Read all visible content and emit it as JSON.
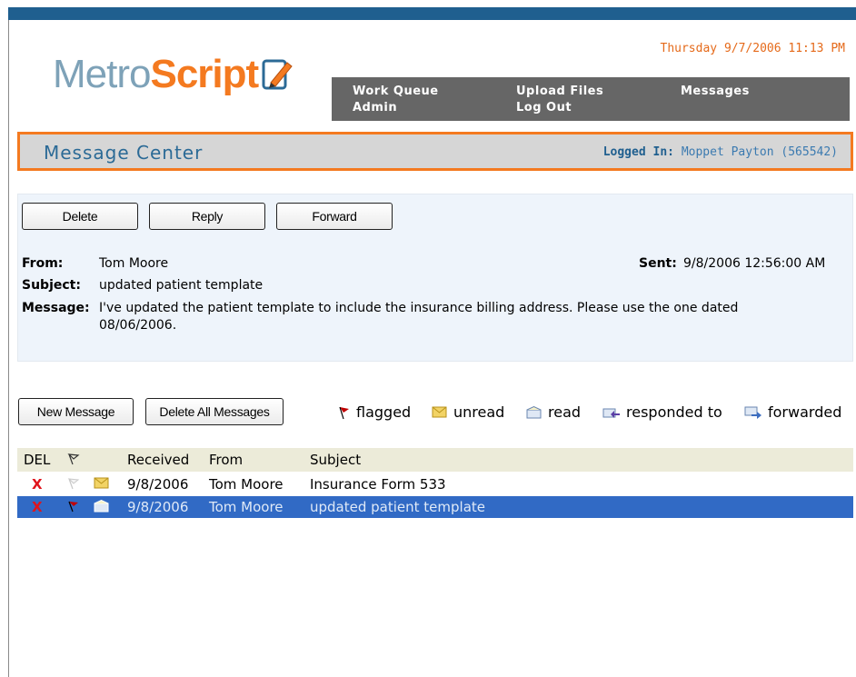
{
  "header": {
    "logo_part1": "Metro",
    "logo_part2": "Script",
    "datetime": "Thursday 9/7/2006 11:13 PM"
  },
  "nav": {
    "items": [
      {
        "label": "Work Queue"
      },
      {
        "label": "Admin"
      },
      {
        "label": "Upload Files"
      },
      {
        "label": "Log Out"
      },
      {
        "label": "Messages"
      }
    ]
  },
  "message_center": {
    "title": "Message Center",
    "logged_in_label": "Logged In:",
    "logged_in_user": "Moppet Payton (565542)"
  },
  "toolbar": {
    "delete_label": "Delete",
    "reply_label": "Reply",
    "forward_label": "Forward"
  },
  "message": {
    "from_label": "From:",
    "from_value": "Tom Moore",
    "sent_label": "Sent:",
    "sent_value": "9/8/2006 12:56:00 AM",
    "subject_label": "Subject:",
    "subject_value": "updated patient template",
    "message_label": "Message:",
    "body_line1": "I've updated the patient template to include the insurance billing address. Please use the one dated",
    "body_line2": "08/06/2006."
  },
  "list_toolbar": {
    "new_message_label": "New Message",
    "delete_all_label": "Delete All Messages"
  },
  "legend": {
    "flagged": "flagged",
    "unread": "unread",
    "read": "read",
    "responded": "responded to",
    "forwarded": "forwarded"
  },
  "table": {
    "columns": {
      "del": "DEL",
      "received": "Received",
      "from": "From",
      "subject": "Subject"
    },
    "rows": [
      {
        "del": "X",
        "received": "9/8/2006",
        "from": "Tom Moore",
        "subject": "Insurance Form 533",
        "flagged": false,
        "status": "unread"
      },
      {
        "del": "X",
        "received": "9/8/2006",
        "from": "Tom Moore",
        "subject": "updated patient template",
        "flagged": true,
        "status": "read"
      }
    ]
  },
  "colors": {
    "accent_orange": "#f47a20",
    "brand_blue": "#1f5f8f",
    "selection_blue": "#316ac5",
    "delete_red": "#e0141c"
  }
}
